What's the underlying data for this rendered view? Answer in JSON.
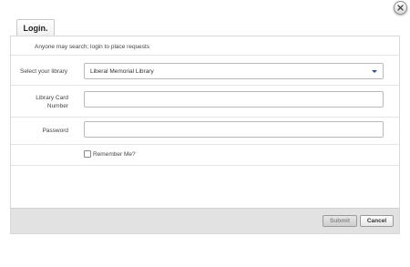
{
  "dialog": {
    "tab_label": "Login.",
    "close_icon": "close-icon",
    "notice": "Anyone may search; login to place requests"
  },
  "form": {
    "library_label": "Select your library",
    "library_selected": "Liberal Memorial Library",
    "card_label_line1": "Library Card",
    "card_label_line2": "Number",
    "card_value": "",
    "password_label": "Password",
    "password_value": "",
    "remember_label": "Remember Me?",
    "remember_checked": false
  },
  "footer": {
    "submit_label": "Submit",
    "cancel_label": "Cancel"
  },
  "colors": {
    "footer_bg": "#e2e2e2",
    "dropdown_arrow": "#2a4f8a"
  }
}
